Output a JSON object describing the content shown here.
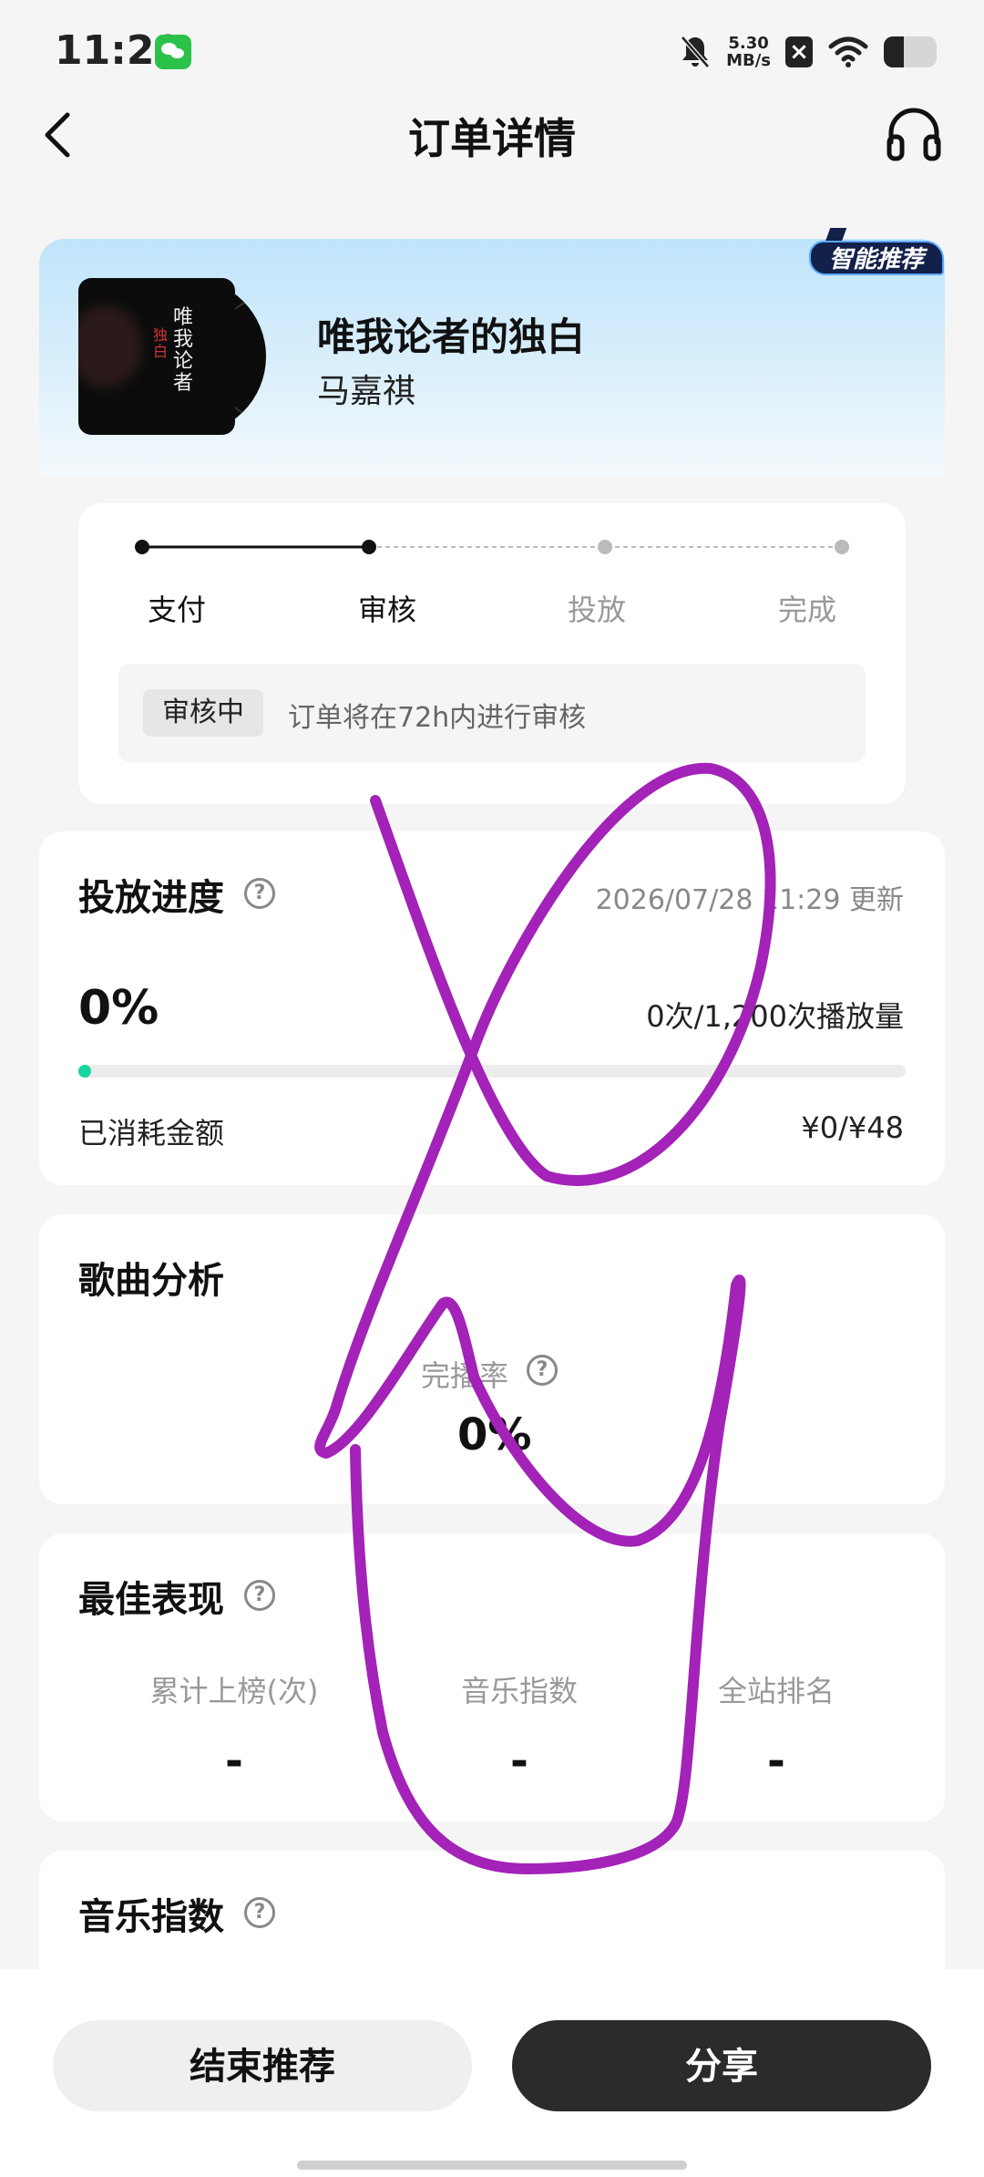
{
  "status_bar": {
    "time": "11:29",
    "speed_value": "5.30",
    "speed_unit": "MB/s"
  },
  "header": {
    "title": "订单详情"
  },
  "song": {
    "title": "唯我论者的独白",
    "artist": "马嘉祺",
    "badge": "智能推荐",
    "cover_text_main": "唯我论者",
    "cover_text_side": "独白"
  },
  "steps": {
    "items": [
      {
        "label": "支付",
        "state": "done"
      },
      {
        "label": "审核",
        "state": "current"
      },
      {
        "label": "投放",
        "state": "todo"
      },
      {
        "label": "完成",
        "state": "todo"
      }
    ],
    "status_pill": "审核中",
    "status_text": "订单将在72h内进行审核"
  },
  "progress": {
    "title": "投放进度",
    "updated": "2026/07/28 11:29 更新",
    "percent_text": "0%",
    "percent_value": 0,
    "plays": "0次/1,200次播放量",
    "spent_label": "已消耗金额",
    "spent_value": "¥0/¥48"
  },
  "analysis": {
    "title": "歌曲分析",
    "metric_label": "完播率",
    "metric_value": "0%"
  },
  "best": {
    "title": "最佳表现",
    "columns": [
      {
        "label": "累计上榜(次)",
        "value": "-"
      },
      {
        "label": "音乐指数",
        "value": "-"
      },
      {
        "label": "全站排名",
        "value": "-"
      }
    ]
  },
  "index": {
    "title": "音乐指数"
  },
  "actions": {
    "end_label": "结束推荐",
    "share_label": "分享"
  },
  "colors": {
    "accent": "#18d4a0",
    "scribble": "#a322b8",
    "dark_button": "#2b2b2b"
  },
  "icons": [
    "wechat-icon",
    "bell-off-icon",
    "wifi-icon",
    "battery-icon",
    "back-icon",
    "headset-icon",
    "help-icon"
  ]
}
